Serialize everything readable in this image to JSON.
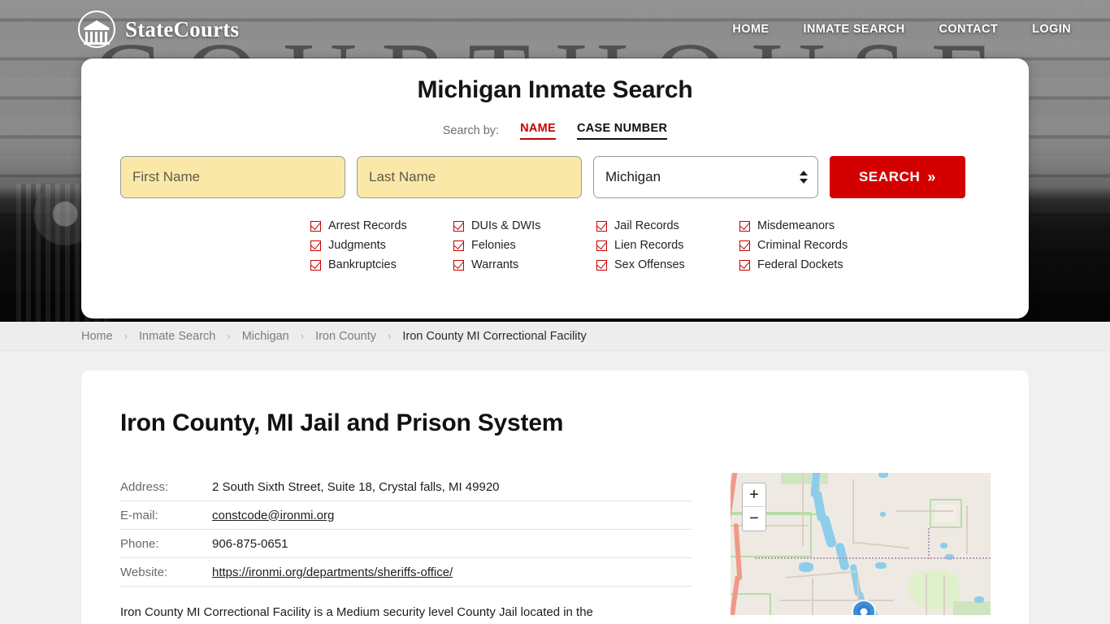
{
  "header": {
    "brand_name": "StateCourts",
    "brand_icon": "courthouse-circle-icon",
    "hero_backdrop_word": "COURTHOUSE",
    "nav": [
      {
        "label": "HOME"
      },
      {
        "label": "INMATE SEARCH"
      },
      {
        "label": "CONTACT"
      },
      {
        "label": "LOGIN"
      }
    ]
  },
  "search_card": {
    "title": "Michigan Inmate Search",
    "search_by_label": "Search by:",
    "tabs": [
      {
        "label": "NAME",
        "active": true
      },
      {
        "label": "CASE NUMBER",
        "active": false
      }
    ],
    "first_name_placeholder": "First Name",
    "first_name_value": "",
    "last_name_placeholder": "Last Name",
    "last_name_value": "",
    "state_selected": "Michigan",
    "search_button_label": "SEARCH",
    "search_button_chevron": "»",
    "record_types": [
      "Arrest Records",
      "DUIs & DWIs",
      "Jail Records",
      "Misdemeanors",
      "Judgments",
      "Felonies",
      "Lien Records",
      "Criminal Records",
      "Bankruptcies",
      "Warrants",
      "Sex Offenses",
      "Federal Dockets"
    ]
  },
  "breadcrumb": {
    "separator": "›",
    "items": [
      {
        "label": "Home",
        "current": false
      },
      {
        "label": "Inmate Search",
        "current": false
      },
      {
        "label": "Michigan",
        "current": false
      },
      {
        "label": "Iron County",
        "current": false
      },
      {
        "label": "Iron County MI Correctional Facility",
        "current": true
      }
    ]
  },
  "main": {
    "page_title": "Iron County, MI Jail and Prison System",
    "details": [
      {
        "label": "Address:",
        "value": "2 South Sixth Street, Suite 18, Crystal falls, MI 49920",
        "link": false
      },
      {
        "label": "E-mail:",
        "value": "constcode@ironmi.org",
        "link": true
      },
      {
        "label": "Phone:",
        "value": "906-875-0651",
        "link": false
      },
      {
        "label": "Website:",
        "value": "https://ironmi.org/departments/sheriffs-office/",
        "link": true
      }
    ],
    "description": "Iron County MI Correctional Facility is a Medium security level County Jail located in the"
  },
  "map": {
    "zoom_in_label": "+",
    "zoom_out_label": "−",
    "marker_name": "facility-location-marker"
  },
  "colors": {
    "accent_red": "#d40000",
    "tab_active_red": "#c40000",
    "input_autofill": "#fae8a8",
    "page_background": "#f0f0f0",
    "breadcrumb_background": "#ededed"
  }
}
